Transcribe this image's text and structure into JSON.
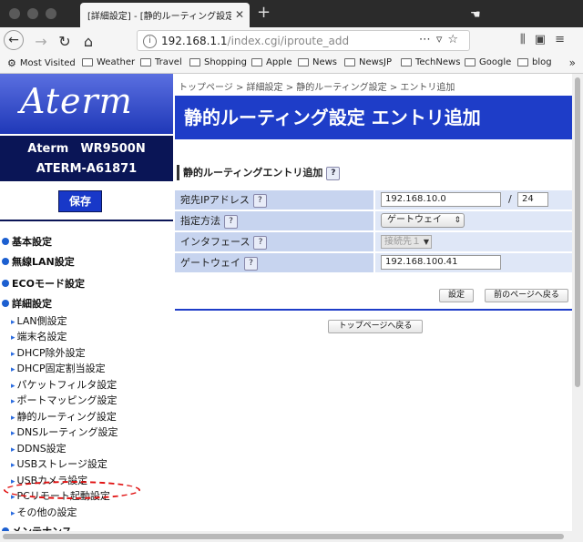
{
  "browser": {
    "tab_title": "[詳細設定] - [静的ルーティング設定 エ",
    "url_host": "192.168.1.1",
    "url_path": "/index.cgi/iproute_add",
    "bookmarks": [
      "Most Visited",
      "Weather",
      "Travel",
      "Shopping",
      "Apple",
      "News",
      "NewsJP",
      "TechNews",
      "Google",
      "blog"
    ]
  },
  "sidebar": {
    "logo": "Aterm",
    "model_line1": "Aterm　WR9500N",
    "model_line2": "ATERM-A61871",
    "save_label": "保存",
    "menu": [
      {
        "label": "基本設定",
        "type": "header"
      },
      {
        "label": "無線LAN設定",
        "type": "header"
      },
      {
        "label": "ECOモード設定",
        "type": "header"
      },
      {
        "label": "詳細設定",
        "type": "header"
      },
      {
        "label": "LAN側設定",
        "type": "item"
      },
      {
        "label": "端末名設定",
        "type": "item"
      },
      {
        "label": "DHCP除外設定",
        "type": "item"
      },
      {
        "label": "DHCP固定割当設定",
        "type": "item"
      },
      {
        "label": "パケットフィルタ設定",
        "type": "item"
      },
      {
        "label": "ポートマッピング設定",
        "type": "item"
      },
      {
        "label": "静的ルーティング設定",
        "type": "item"
      },
      {
        "label": "DNSルーティング設定",
        "type": "item"
      },
      {
        "label": "DDNS設定",
        "type": "item"
      },
      {
        "label": "USBストレージ設定",
        "type": "item"
      },
      {
        "label": "USBカメラ設定",
        "type": "item"
      },
      {
        "label": "PCリモート起動設定",
        "type": "item"
      },
      {
        "label": "その他の設定",
        "type": "item"
      },
      {
        "label": "メンテナンス",
        "type": "header"
      }
    ]
  },
  "content": {
    "breadcrumb": "トップページ > 詳細設定 > 静的ルーティング設定 > エントリ追加",
    "title": "静的ルーティング設定 エントリ追加",
    "section_title": "静的ルーティングエントリ追加",
    "help_mark": "?",
    "rows": [
      {
        "label": "宛先IPアドレス",
        "value": "192.168.10.0",
        "slash": "/",
        "prefix": "24"
      },
      {
        "label": "指定方法",
        "value": "ゲートウェイ"
      },
      {
        "label": "インタフェース",
        "value": "接続先１"
      },
      {
        "label": "ゲートウェイ",
        "value": "192.168.100.41"
      }
    ],
    "set_button": "設定",
    "back_button": "前のページへ戻る",
    "top_button": "トップページへ戻る"
  },
  "colors": {
    "accent": "#1e3dc8",
    "navy": "#0a1556",
    "label_bg": "#c7d4ef",
    "value_bg": "#dfe7f7",
    "annotation": "#e01010"
  },
  "icons": [
    "back-icon",
    "forward-icon",
    "reload-icon",
    "home-icon",
    "info-icon",
    "more-icon",
    "pocket-icon",
    "bookmark-star-icon",
    "library-icon",
    "sidebar-icon",
    "menu-icon",
    "folder-icon",
    "settings-icon"
  ]
}
